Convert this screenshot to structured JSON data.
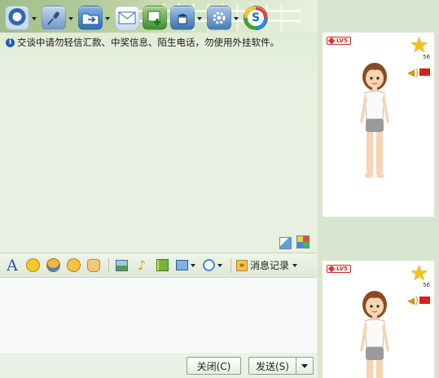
{
  "notice": {
    "text": "交谈中请勿轻信汇款、中奖信息、陌生电话，勿使用外挂软件。"
  },
  "toolbar": {
    "buttons": [
      {
        "name": "video-icon",
        "glyph": "●"
      },
      {
        "name": "microphone-icon",
        "glyph": "🎤"
      },
      {
        "name": "folder-transfer-icon",
        "glyph": "▭"
      },
      {
        "name": "mail-icon",
        "glyph": "✉"
      },
      {
        "name": "add-app-icon",
        "glyph": "+"
      },
      {
        "name": "contacts-icon",
        "glyph": "☎"
      },
      {
        "name": "settings-icon",
        "glyph": "⚙"
      },
      {
        "name": "soso-icon",
        "glyph": "S"
      }
    ]
  },
  "format_toolbar": {
    "font_glyph": "A",
    "history_label": "消息记录"
  },
  "buttons": {
    "close_label": "关闭(C)",
    "send_label": "发送(S)"
  },
  "profiles": [
    {
      "level_badge": "LV5",
      "star_level": "56"
    },
    {
      "level_badge": "LV5",
      "star_level": "56"
    }
  ],
  "colors": {
    "accent": "#3c6ea8",
    "background": "#e7efe0",
    "badge_red": "#d02a2a",
    "star": "#f3c21a"
  }
}
